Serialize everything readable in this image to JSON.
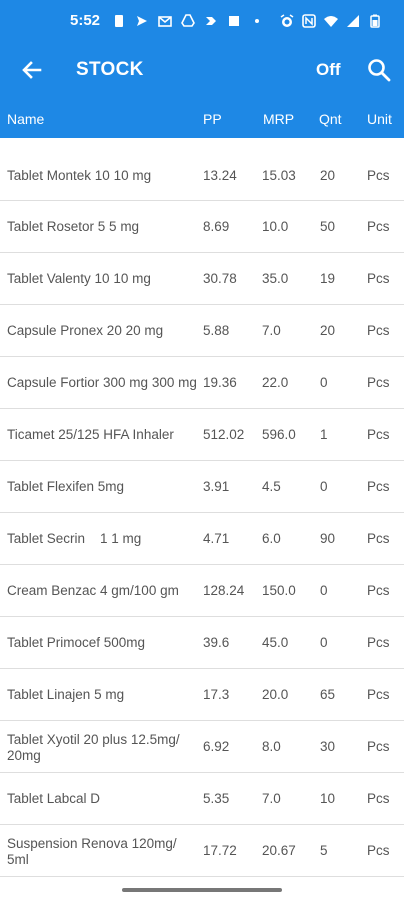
{
  "status_bar": {
    "time": "5:52",
    "icons_left": [
      "sim-card-icon",
      "send-icon",
      "gmail-icon",
      "drive-icon",
      "arrow-icon",
      "square-icon",
      "dot-icon"
    ],
    "icons_right": [
      "alarm-icon",
      "nfc-icon",
      "wifi-icon",
      "signal-icon",
      "battery-icon"
    ]
  },
  "app_bar": {
    "title": "STOCK",
    "toggle_label": "Off",
    "background": "#1e88e5"
  },
  "columns": {
    "name": "Name",
    "pp": "PP",
    "mrp": "MRP",
    "qnt": "Qnt",
    "unit": "Unit"
  },
  "rows": [
    {
      "name": "Tablet Montek 10 10 mg",
      "pp": "13.24",
      "mrp": "15.03",
      "qnt": "20",
      "unit": "Pcs"
    },
    {
      "name": "Tablet Rosetor 5 5 mg",
      "pp": "8.69",
      "mrp": "10.0",
      "qnt": "50",
      "unit": "Pcs"
    },
    {
      "name": "Tablet Valenty 10 10 mg",
      "pp": "30.78",
      "mrp": "35.0",
      "qnt": "19",
      "unit": "Pcs"
    },
    {
      "name": "Capsule Pronex 20 20 mg",
      "pp": "5.88",
      "mrp": "7.0",
      "qnt": "20",
      "unit": "Pcs"
    },
    {
      "name": "Capsule Fortior 300 mg 300 mg",
      "pp": "19.36",
      "mrp": "22.0",
      "qnt": "0",
      "unit": "Pcs"
    },
    {
      "name": "Ticamet 25/125 HFA Inhaler",
      "pp": "512.02",
      "mrp": "596.0",
      "qnt": "1",
      "unit": "Pcs"
    },
    {
      "name": "Tablet Flexifen 5mg",
      "pp": "3.91",
      "mrp": "4.5",
      "qnt": "0",
      "unit": "Pcs"
    },
    {
      "name": "Tablet Secrin    1 1 mg",
      "pp": "4.71",
      "mrp": "6.0",
      "qnt": "90",
      "unit": "Pcs"
    },
    {
      "name": "Cream Benzac 4 gm/100 gm",
      "pp": "128.24",
      "mrp": "150.0",
      "qnt": "0",
      "unit": "Pcs"
    },
    {
      "name": "Tablet Primocef 500mg",
      "pp": "39.6",
      "mrp": "45.0",
      "qnt": "0",
      "unit": "Pcs"
    },
    {
      "name": "Tablet Linajen 5 mg",
      "pp": "17.3",
      "mrp": "20.0",
      "qnt": "65",
      "unit": "Pcs"
    },
    {
      "name": "Tablet Xyotil 20 plus  12.5mg/ 20mg",
      "pp": "6.92",
      "mrp": "8.0",
      "qnt": "30",
      "unit": "Pcs"
    },
    {
      "name": "Tablet Labcal D",
      "pp": "5.35",
      "mrp": "7.0",
      "qnt": "10",
      "unit": "Pcs"
    },
    {
      "name": "Suspension Renova 120mg/ 5ml",
      "pp": "17.72",
      "mrp": "20.67",
      "qnt": "5",
      "unit": "Pcs"
    }
  ]
}
